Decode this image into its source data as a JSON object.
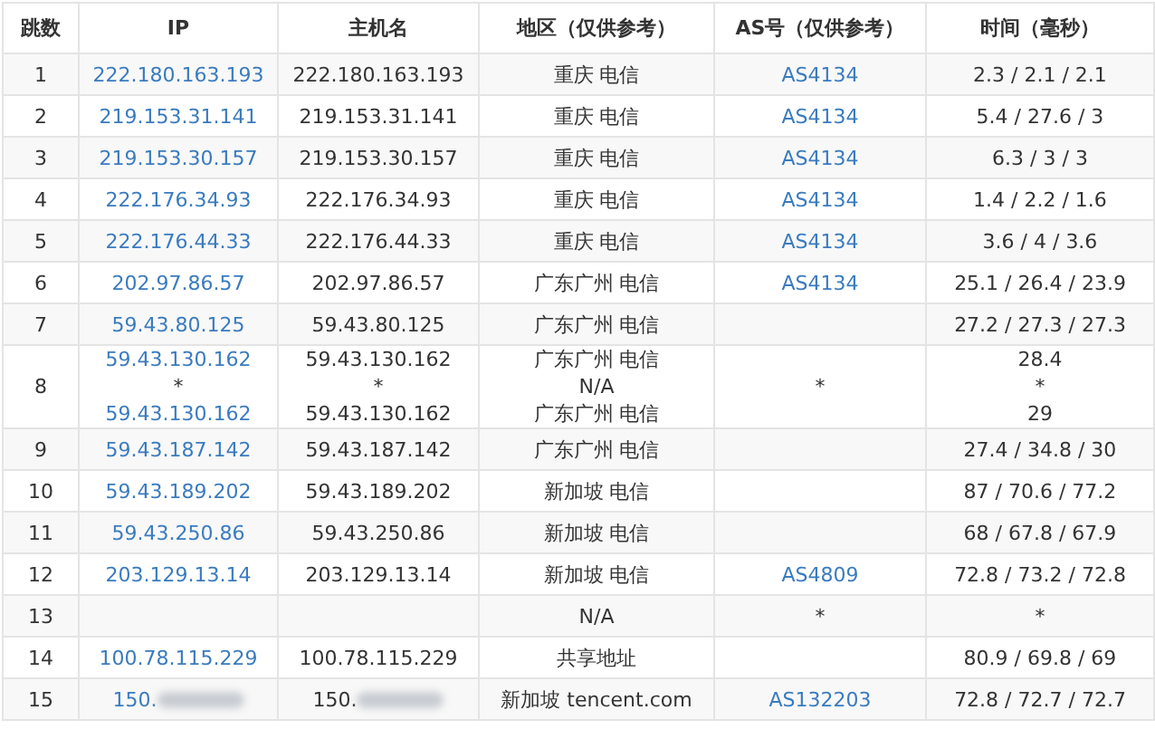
{
  "columns": [
    "跳数",
    "IP",
    "主机名",
    "地区（仅供参考）",
    "AS号（仅供参考）",
    "时间（毫秒）"
  ],
  "rows": [
    {
      "hop": "1",
      "ip": [
        "222.180.163.193"
      ],
      "host": [
        "222.180.163.193"
      ],
      "region": [
        "重庆 电信"
      ],
      "as": [
        "AS4134"
      ],
      "time": [
        "2.3 / 2.1 / 2.1"
      ]
    },
    {
      "hop": "2",
      "ip": [
        "219.153.31.141"
      ],
      "host": [
        "219.153.31.141"
      ],
      "region": [
        "重庆 电信"
      ],
      "as": [
        "AS4134"
      ],
      "time": [
        "5.4 / 27.6 / 3"
      ]
    },
    {
      "hop": "3",
      "ip": [
        "219.153.30.157"
      ],
      "host": [
        "219.153.30.157"
      ],
      "region": [
        "重庆 电信"
      ],
      "as": [
        "AS4134"
      ],
      "time": [
        "6.3 / 3 / 3"
      ]
    },
    {
      "hop": "4",
      "ip": [
        "222.176.34.93"
      ],
      "host": [
        "222.176.34.93"
      ],
      "region": [
        "重庆 电信"
      ],
      "as": [
        "AS4134"
      ],
      "time": [
        "1.4 / 2.2 / 1.6"
      ]
    },
    {
      "hop": "5",
      "ip": [
        "222.176.44.33"
      ],
      "host": [
        "222.176.44.33"
      ],
      "region": [
        "重庆 电信"
      ],
      "as": [
        "AS4134"
      ],
      "time": [
        "3.6 / 4 / 3.6"
      ]
    },
    {
      "hop": "6",
      "ip": [
        "202.97.86.57"
      ],
      "host": [
        "202.97.86.57"
      ],
      "region": [
        "广东广州 电信"
      ],
      "as": [
        "AS4134"
      ],
      "time": [
        "25.1 / 26.4 / 23.9"
      ]
    },
    {
      "hop": "7",
      "ip": [
        "59.43.80.125"
      ],
      "host": [
        "59.43.80.125"
      ],
      "region": [
        "广东广州 电信"
      ],
      "as": [],
      "time": [
        "27.2 / 27.3 / 27.3"
      ]
    },
    {
      "hop": "8",
      "ip": [
        "59.43.130.162",
        "*",
        "59.43.130.162"
      ],
      "host": [
        "59.43.130.162",
        "*",
        "59.43.130.162"
      ],
      "region": [
        "广东广州 电信",
        "N/A",
        "广东广州 电信"
      ],
      "as": [
        "*"
      ],
      "time": [
        "28.4",
        "*",
        "29"
      ]
    },
    {
      "hop": "9",
      "ip": [
        "59.43.187.142"
      ],
      "host": [
        "59.43.187.142"
      ],
      "region": [
        "广东广州 电信"
      ],
      "as": [],
      "time": [
        "27.4 / 34.8 / 30"
      ]
    },
    {
      "hop": "10",
      "ip": [
        "59.43.189.202"
      ],
      "host": [
        "59.43.189.202"
      ],
      "region": [
        "新加坡 电信"
      ],
      "as": [],
      "time": [
        "87 / 70.6 / 77.2"
      ]
    },
    {
      "hop": "11",
      "ip": [
        "59.43.250.86"
      ],
      "host": [
        "59.43.250.86"
      ],
      "region": [
        "新加坡 电信"
      ],
      "as": [],
      "time": [
        "68 / 67.8 / 67.9"
      ]
    },
    {
      "hop": "12",
      "ip": [
        "203.129.13.14"
      ],
      "host": [
        "203.129.13.14"
      ],
      "region": [
        "新加坡 电信"
      ],
      "as": [
        "AS4809"
      ],
      "time": [
        "72.8 / 73.2 / 72.8"
      ]
    },
    {
      "hop": "13",
      "ip": [],
      "host": [],
      "region": [
        "N/A"
      ],
      "as": [
        "*"
      ],
      "time": [
        "*"
      ]
    },
    {
      "hop": "14",
      "ip": [
        "100.78.115.229"
      ],
      "host": [
        "100.78.115.229"
      ],
      "region": [
        "共享地址"
      ],
      "as": [],
      "time": [
        "80.9 / 69.8 / 69"
      ]
    },
    {
      "hop": "15",
      "ip": [
        "150."
      ],
      "host": [
        "150."
      ],
      "redacted": true,
      "region": [
        "新加坡 tencent.com"
      ],
      "as": [
        "AS132203"
      ],
      "time": [
        "72.8 / 72.7 / 72.7"
      ]
    }
  ]
}
